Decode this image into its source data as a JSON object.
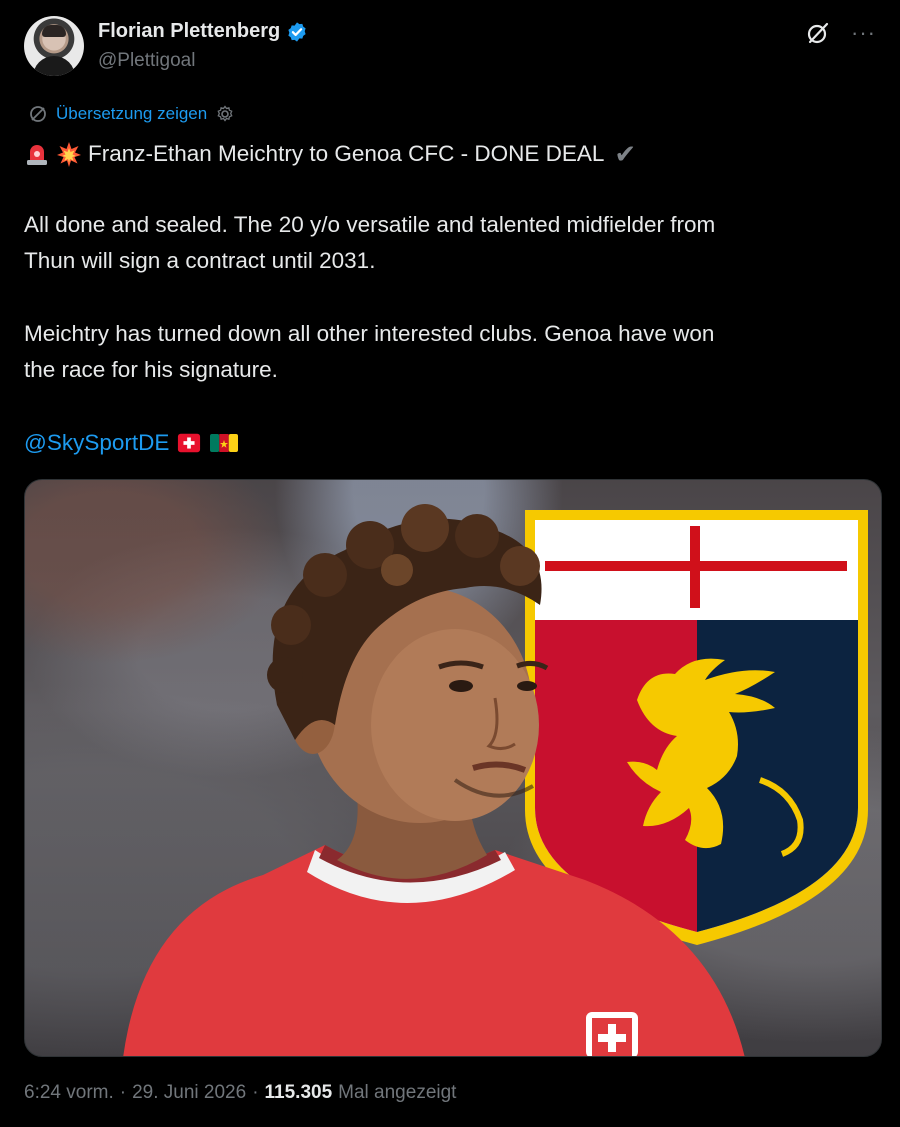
{
  "author": {
    "name": "Florian Plettenberg",
    "handle": "@Plettigoal"
  },
  "translate_label": "Übersetzung zeigen",
  "tweet": {
    "line1": "Franz-Ethan Meichtry to Genoa CFC - DONE DEAL",
    "para2_a": "All done and sealed. The 20 y/o versatile and talented midfielder from",
    "para2_b": "Thun will sign a contract until 2031.",
    "para3_a": "Meichtry has turned down all other interested clubs. Genoa have won",
    "para3_b": "the race for his signature.",
    "mention": "@SkySportDE"
  },
  "icons": [
    "verified-icon",
    "grok-icon",
    "more-icon",
    "translate-icon",
    "settings-icon",
    "siren-emoji",
    "collision-emoji",
    "check-emoji",
    "swiss-flag-emoji",
    "cameroon-flag-emoji"
  ],
  "colors": {
    "accent": "#1d9bf0",
    "background": "#000000",
    "text": "#e7e9ea",
    "muted": "#71767b"
  },
  "meta": {
    "time": "6:24 vorm.",
    "sep1": "·",
    "date": "29. Juni 2026",
    "sep2": "·",
    "views": "115.305",
    "views_label": "Mal angezeigt"
  }
}
